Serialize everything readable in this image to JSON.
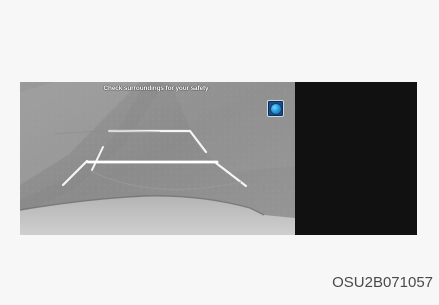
{
  "camera_screen": {
    "warning_text": "Check surroundings for your safety",
    "settings_icon": "camera-icon"
  },
  "figure": {
    "code": "OSU2B071057"
  },
  "colors": {
    "background": "#f7f7f7",
    "camera_panel": "#8e8e8e",
    "right_panel": "#111111",
    "guide_lines": "#f5f5f5",
    "button_blue": "#1b4e84"
  }
}
